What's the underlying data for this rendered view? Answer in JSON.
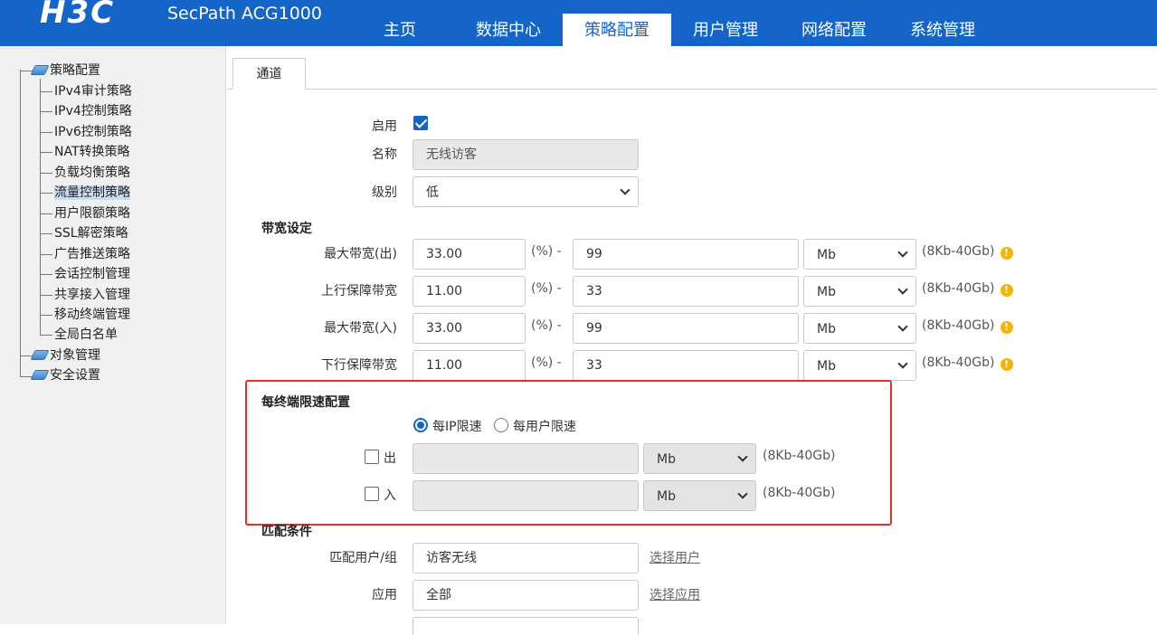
{
  "header": {
    "logo": "H3C",
    "product": "SecPath ACG1000",
    "nav": [
      "主页",
      "数据中心",
      "策略配置",
      "用户管理",
      "网络配置",
      "系统管理"
    ],
    "active_nav": "策略配置"
  },
  "sidebar": {
    "root": "策略配置",
    "items": [
      "IPv4审计策略",
      "IPv4控制策略",
      "IPv6控制策略",
      "NAT转换策略",
      "负载均衡策略",
      "流量控制策略",
      "用户限额策略",
      "SSL解密策略",
      "广告推送策略",
      "会话控制管理",
      "共享接入管理",
      "移动终端管理",
      "全局白名单"
    ],
    "selected": "流量控制策略",
    "others": [
      "对象管理",
      "安全设置"
    ]
  },
  "tab": {
    "label": "通道"
  },
  "form": {
    "enable_label": "启用",
    "enabled": true,
    "name_label": "名称",
    "name_value": "无线访客",
    "level_label": "级别",
    "level_value": "低"
  },
  "bandwidth": {
    "section_title": "带宽设定",
    "percent_sep": "(%) -",
    "range_hint": "(8Kb-40Gb)",
    "warn_glyph": "!",
    "rows": [
      {
        "label": "最大带宽(出)",
        "percent": "33.00",
        "value": "99",
        "unit": "Mb"
      },
      {
        "label": "上行保障带宽",
        "percent": "11.00",
        "value": "33",
        "unit": "Mb"
      },
      {
        "label": "最大带宽(入)",
        "percent": "33.00",
        "value": "99",
        "unit": "Mb"
      },
      {
        "label": "下行保障带宽",
        "percent": "11.00",
        "value": "33",
        "unit": "Mb"
      }
    ]
  },
  "per_terminal": {
    "section_title": "每终端限速配置",
    "radio_ip": "每IP限速",
    "radio_user": "每用户限速",
    "selected": "每IP限速",
    "out_label": "出",
    "in_label": "入",
    "out_unit": "Mb",
    "in_unit": "Mb",
    "range_hint": "(8Kb-40Gb)"
  },
  "match": {
    "section_title": "匹配条件",
    "user_label": "匹配用户/组",
    "user_value": "访客无线",
    "user_link": "选择用户",
    "app_label": "应用",
    "app_value": "全部",
    "app_link": "选择应用"
  },
  "colors": {
    "brand": "#1565c8",
    "highlight": "#e0302a",
    "warn": "#f5b400"
  }
}
